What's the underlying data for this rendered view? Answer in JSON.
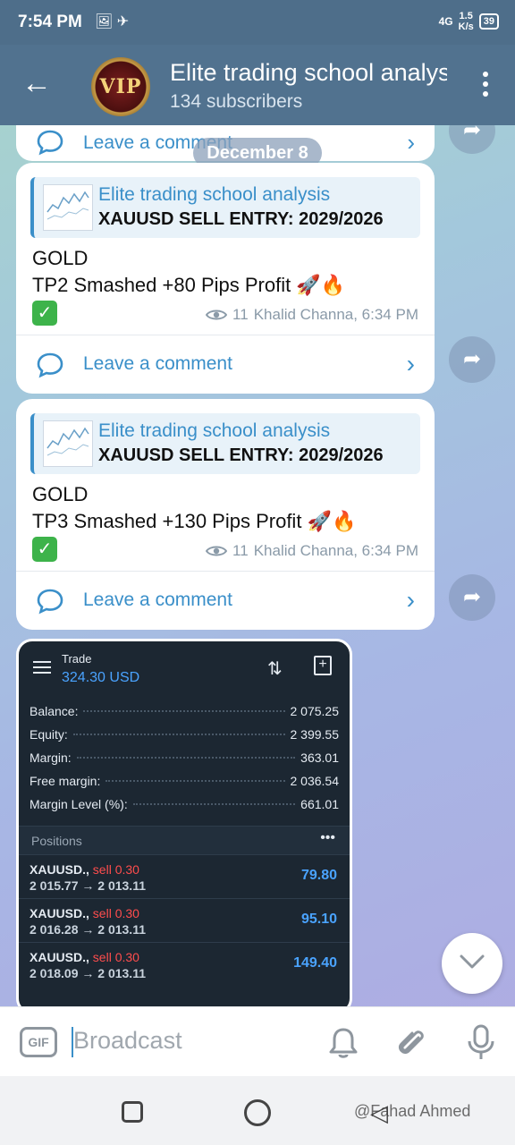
{
  "status_bar": {
    "time": "7:54 PM",
    "network_speed": "1.5",
    "network_unit": "K/s",
    "battery": "39",
    "signal_label": "4G"
  },
  "header": {
    "avatar_text": "VIP",
    "channel_title": "Elite trading school analysis",
    "subscribers": "134 subscribers"
  },
  "chat": {
    "date_separator": "December 8",
    "posts": [
      {
        "reply_title": "Elite trading school analysis",
        "reply_text": "XAUUSD SELL   ENTRY: 2029/2026",
        "line1": "GOLD",
        "line2": "TP2  Smashed +80 Pips Profit 🚀🔥",
        "views": "11",
        "author_time": "Khalid Channa, 6:34 PM",
        "comment_label": "Leave a comment"
      },
      {
        "reply_title": "Elite trading school analysis",
        "reply_text": "XAUUSD SELL   ENTRY: 2029/2026",
        "line1": "GOLD",
        "line2": "TP3  Smashed +130 Pips Profit 🚀🔥",
        "views": "11",
        "author_time": "Khalid Channa, 6:34 PM",
        "comment_label": "Leave a comment"
      }
    ],
    "partial_comment_label": "Leave a comment"
  },
  "trade_screenshot": {
    "title": "Trade",
    "amount": "324.30 USD",
    "rows": [
      {
        "label": "Balance:",
        "value": "2 075.25"
      },
      {
        "label": "Equity:",
        "value": "2 399.55"
      },
      {
        "label": "Margin:",
        "value": "363.01"
      },
      {
        "label": "Free margin:",
        "value": "2 036.54"
      },
      {
        "label": "Margin Level (%):",
        "value": "661.01"
      }
    ],
    "positions_label": "Positions",
    "positions": [
      {
        "symbol": "XAUUSD.,",
        "side": "sell 0.30",
        "prices": "2 015.77 → 2 013.11",
        "profit": "79.80"
      },
      {
        "symbol": "XAUUSD.,",
        "side": "sell 0.30",
        "prices": "2 016.28 → 2 013.11",
        "profit": "95.10"
      },
      {
        "symbol": "XAUUSD.,",
        "side": "sell 0.30",
        "prices": "2 018.09 → 2 013.11",
        "profit": "149.40"
      }
    ]
  },
  "input": {
    "gif_label": "GIF",
    "placeholder": "Broadcast"
  },
  "watermark": "@Fahad Ahmed",
  "colors": {
    "header": "#51728f",
    "accent": "#3a8fc9",
    "profit": "#4aa3ff",
    "sell": "#ff4d4d"
  }
}
